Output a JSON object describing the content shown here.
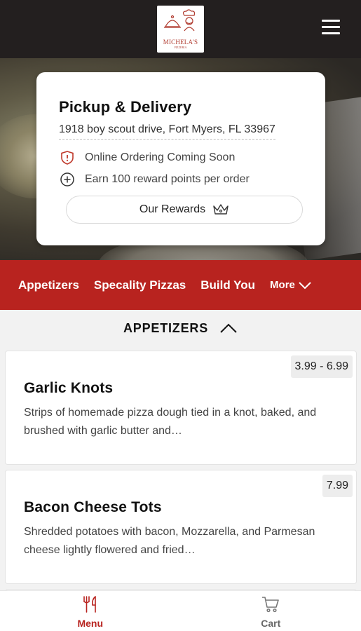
{
  "header": {
    "logo_text": "MICHELA'S",
    "logo_subtext": "PIZZERIA"
  },
  "info": {
    "title": "Pickup & Delivery",
    "address": "1918 boy scout drive, Fort Myers, FL 33967",
    "ordering_status": "Online Ordering Coming Soon",
    "rewards_note": "Earn 100 reward points per order",
    "rewards_button": "Our Rewards"
  },
  "categories": {
    "items": [
      "Appetizers",
      "Specality Pizzas",
      "Build You"
    ],
    "more_label": "More"
  },
  "section": {
    "title": "APPETIZERS"
  },
  "menu_items": [
    {
      "name": "Garlic Knots",
      "price": "3.99 - 6.99",
      "description": "Strips of homemade pizza dough tied in a knot, baked, and brushed with garlic butter and…"
    },
    {
      "name": "Bacon Cheese Tots",
      "price": "7.99",
      "description": "Shredded potatoes with bacon, Mozzarella, and Parmesan cheese lightly flowered and fried…"
    }
  ],
  "bottom_nav": {
    "menu_label": "Menu",
    "cart_label": "Cart"
  },
  "colors": {
    "brand_red": "#b8231f",
    "header_dark": "#231f1f"
  }
}
